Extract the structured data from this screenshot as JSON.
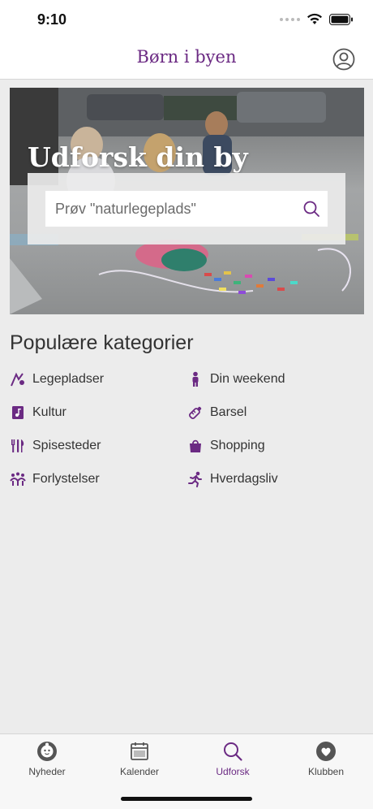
{
  "status_bar": {
    "time": "9:10"
  },
  "header": {
    "title": "Børn i byen"
  },
  "hero": {
    "title": "Udforsk din by",
    "search_placeholder": "Prøv \"naturlegeplads\""
  },
  "categories": {
    "title": "Populære kategorier",
    "items": [
      {
        "label": "Legepladser",
        "icon": "playground-icon"
      },
      {
        "label": "Din weekend",
        "icon": "child-icon"
      },
      {
        "label": "Kultur",
        "icon": "music-book-icon"
      },
      {
        "label": "Barsel",
        "icon": "baby-bottle-icon"
      },
      {
        "label": "Spisesteder",
        "icon": "cutlery-icon"
      },
      {
        "label": "Shopping",
        "icon": "shopping-bag-icon"
      },
      {
        "label": "Forlystelser",
        "icon": "amusement-icon"
      },
      {
        "label": "Hverdagsliv",
        "icon": "running-person-icon"
      }
    ]
  },
  "tab_bar": {
    "active": "Udforsk",
    "tabs": [
      {
        "label": "Nyheder",
        "icon": "baby-face-icon"
      },
      {
        "label": "Kalender",
        "icon": "calendar-icon"
      },
      {
        "label": "Udforsk",
        "icon": "search-icon"
      },
      {
        "label": "Klubben",
        "icon": "heart-icon"
      }
    ]
  },
  "colors": {
    "accent": "#6b2a83",
    "background": "#ececec"
  }
}
